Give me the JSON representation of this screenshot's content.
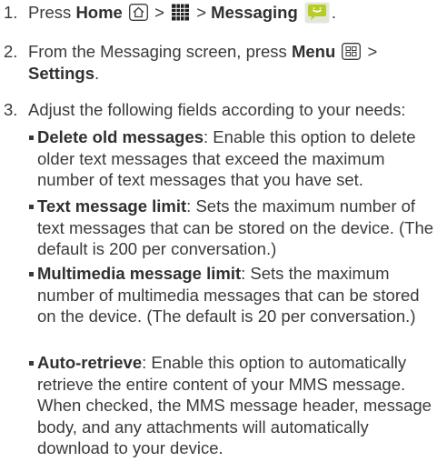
{
  "steps": [
    {
      "number": "1.",
      "press": "Press",
      "home": "Home",
      "gt1": ">",
      "gt2": ">",
      "messaging": "Messaging",
      "period": "."
    },
    {
      "number": "2.",
      "pre": "From the Messaging screen, press",
      "menu": "Menu",
      "gt": ">",
      "settings": "Settings",
      "period": "."
    },
    {
      "number": "3.",
      "text": "Adjust the following fields according to your needs:"
    }
  ],
  "options": [
    {
      "term": "Delete old messages",
      "description": ": Enable this option to delete older text messages that exceed the maximum number of text messages that you have set."
    },
    {
      "term": "Text message limit",
      "description": ": Sets the maximum number of text messages that can be stored on the device. (The default is 200 per conversation.)"
    },
    {
      "term": "Multimedia message limit",
      "description": ": Sets the maximum number of multimedia messages that can be stored on the device. (The default is 20 per conversation.)"
    },
    {
      "term": "Auto-retrieve",
      "description": ": Enable this option to automatically retrieve the entire content of your MMS message. When checked, the MMS message header, message body, and any attachments will automatically download to your device."
    }
  ],
  "icons": {
    "home": "home-key-icon",
    "apps": "applications-grid-icon",
    "messaging": "messaging-app-icon",
    "menu": "menu-key-icon"
  },
  "colors": {
    "text": "#3a3a3a",
    "messaging_icon": "#b8cc28"
  }
}
